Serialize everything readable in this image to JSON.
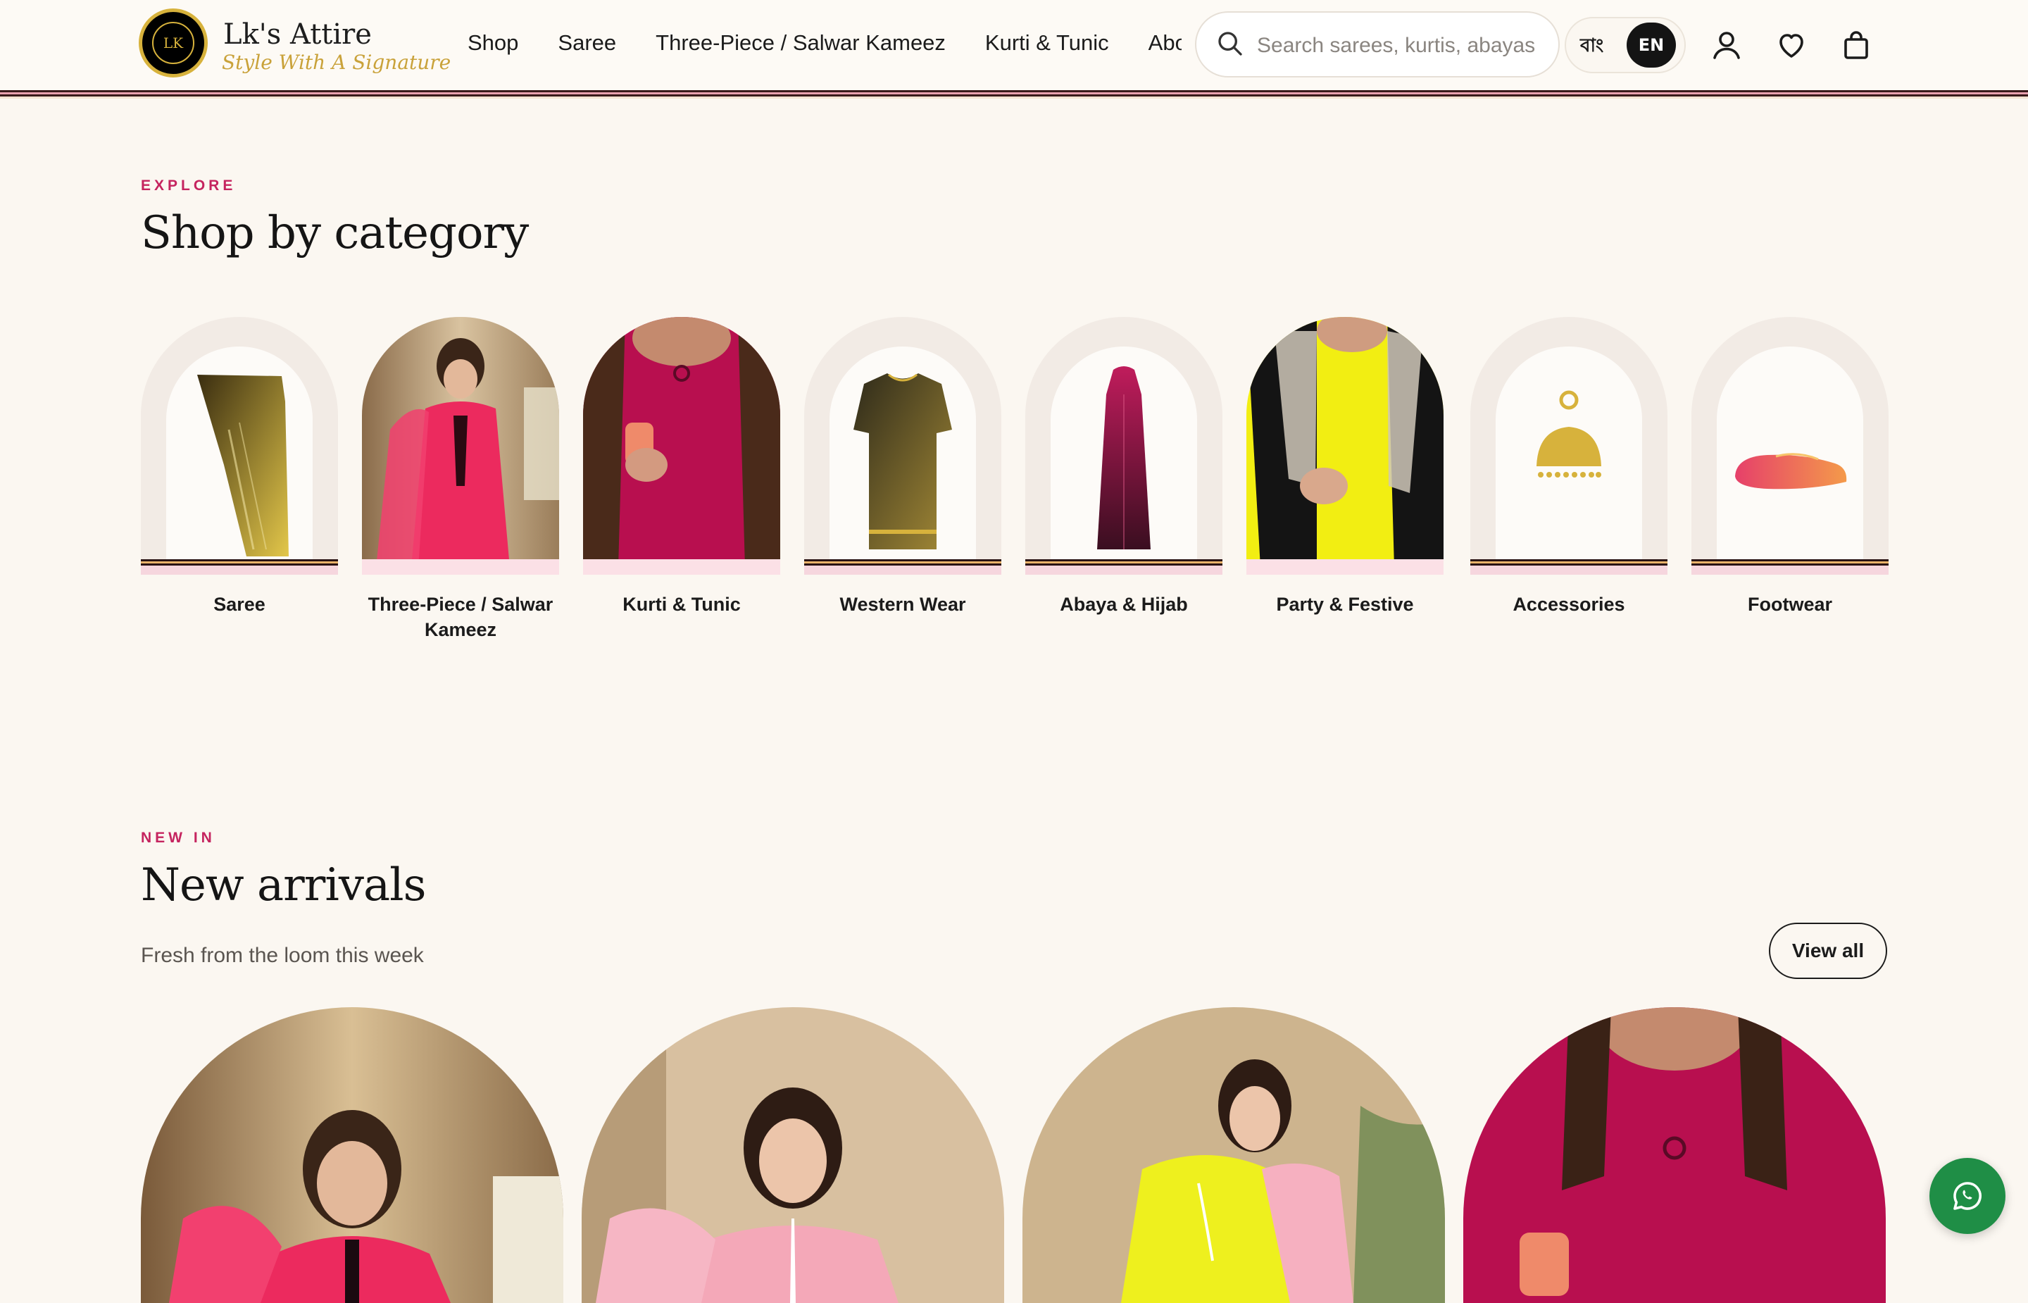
{
  "header": {
    "brand_name": "Lk's Attire",
    "brand_tagline": "Style With A Signature",
    "logo_monogram": "LK",
    "nav": [
      "Shop",
      "Saree",
      "Three-Piece / Salwar Kameez",
      "Kurti & Tunic",
      "Abou"
    ],
    "search_placeholder": "Search sarees, kurtis, abayas",
    "lang_bn": "বাং",
    "lang_en": "EN"
  },
  "categories_section": {
    "eyebrow": "EXPLORE",
    "title": "Shop by category",
    "items": [
      {
        "label": "Saree",
        "icon": "saree-icon"
      },
      {
        "label": "Three-Piece / Salwar Kameez",
        "icon": "three-piece-photo"
      },
      {
        "label": "Kurti & Tunic",
        "icon": "kurti-photo"
      },
      {
        "label": "Western Wear",
        "icon": "dress-icon"
      },
      {
        "label": "Abaya & Hijab",
        "icon": "abaya-icon"
      },
      {
        "label": "Party & Festive",
        "icon": "party-photo"
      },
      {
        "label": "Accessories",
        "icon": "earring-icon"
      },
      {
        "label": "Footwear",
        "icon": "shoe-icon"
      }
    ]
  },
  "arrivals_section": {
    "eyebrow": "NEW IN",
    "title": "New arrivals",
    "subtitle": "Fresh from the loom this week",
    "view_all": "View all"
  },
  "colors": {
    "accent": "#c5245f",
    "gold": "#d7b23c",
    "whatsapp": "#1f8e46"
  }
}
